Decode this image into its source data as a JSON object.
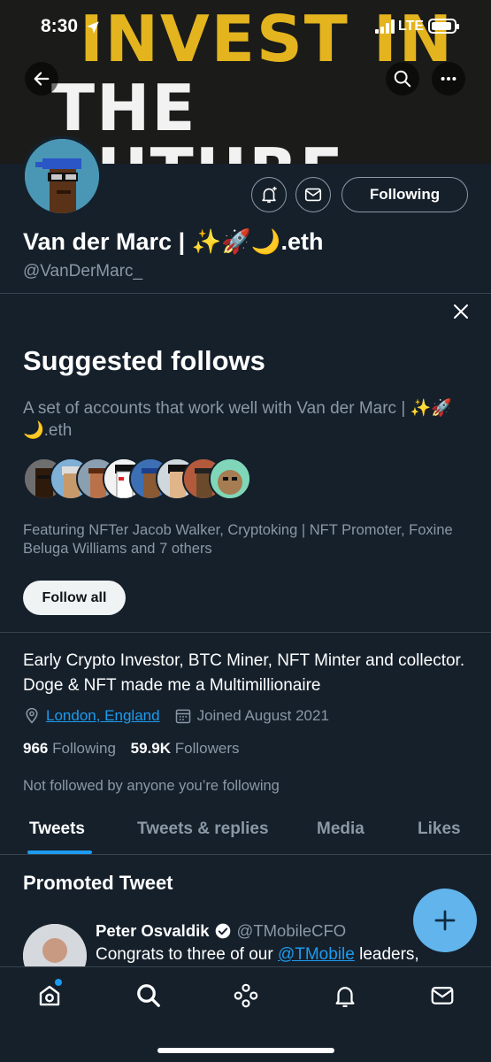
{
  "status_bar": {
    "time": "8:30",
    "network": "LTE"
  },
  "banner": {
    "line1": "INVEST IN",
    "line2": "THE FUTURE"
  },
  "profile": {
    "name": "Van der Marc | ✨🚀🌙.eth",
    "handle": "@VanDerMarc_",
    "following_button": "Following",
    "bio": "Early Crypto Investor, BTC Miner, NFT Minter and collector. Doge & NFT made me a Multimillionaire",
    "location": "London, England",
    "joined": "Joined August 2021",
    "following_count": "966",
    "following_label": "Following",
    "followers_count": "59.9K",
    "followers_label": "Followers",
    "not_followed": "Not followed by anyone you’re following"
  },
  "suggested": {
    "title": "Suggested follows",
    "description": "A set of accounts that work well with Van der Marc | ✨🚀🌙.eth",
    "featuring": "Featuring NFTer Jacob Walker, Cryptoking | NFT Promoter, Foxine Beluga Williams and 7 others",
    "follow_all": "Follow all"
  },
  "tabs": [
    "Tweets",
    "Tweets & replies",
    "Media",
    "Likes"
  ],
  "promoted": {
    "heading": "Promoted Tweet",
    "author": "Peter Osvaldik",
    "handle": "@TMobileCFO",
    "text_before": "Congrats to three of our ",
    "mention": "@TMobile",
    "text_after": " leaders,"
  },
  "colors": {
    "background": "#15202b",
    "accent": "#1d9bf0",
    "muted": "#8b98a5",
    "fab": "#61b4ec"
  },
  "icons": [
    "back-arrow-icon",
    "search-icon",
    "more-icon",
    "notification-bell-icon",
    "mail-icon",
    "close-icon",
    "location-pin-icon",
    "calendar-icon",
    "verified-badge-icon",
    "plus-icon",
    "home-icon",
    "explore-icon",
    "spaces-icon",
    "bell-icon",
    "messages-icon"
  ]
}
